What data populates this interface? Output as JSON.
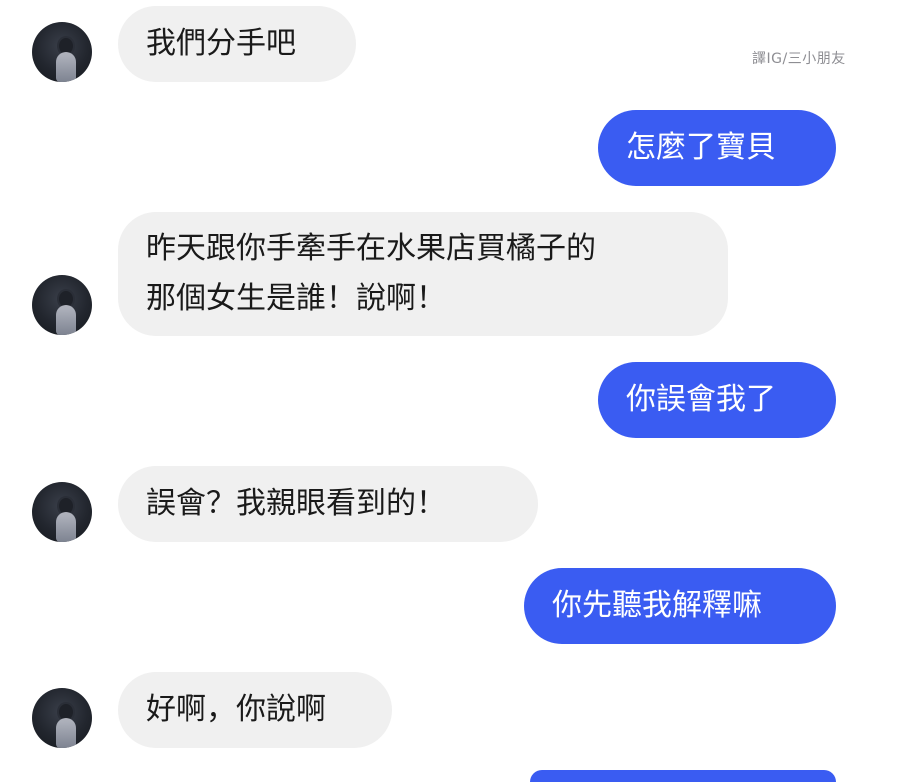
{
  "credit": "譯IG/三小朋友",
  "messages": [
    {
      "side": "in",
      "lines": [
        "我們分手吧"
      ]
    },
    {
      "side": "out",
      "lines": [
        "怎麼了寶貝"
      ]
    },
    {
      "side": "in",
      "lines": [
        "昨天跟你手牽手在水果店買橘子的",
        "那個女生是誰！說啊！"
      ]
    },
    {
      "side": "out",
      "lines": [
        "你誤會我了"
      ]
    },
    {
      "side": "in",
      "lines": [
        "誤會？我親眼看到的！"
      ]
    },
    {
      "side": "out",
      "lines": [
        "你先聽我解釋嘛"
      ]
    },
    {
      "side": "in",
      "lines": [
        "好啊，你說啊"
      ]
    }
  ],
  "colors": {
    "incoming_bubble": "#f0f0f0",
    "outgoing_bubble": "#3a5cf2",
    "incoming_text": "#1a1a1a",
    "outgoing_text": "#ffffff"
  }
}
